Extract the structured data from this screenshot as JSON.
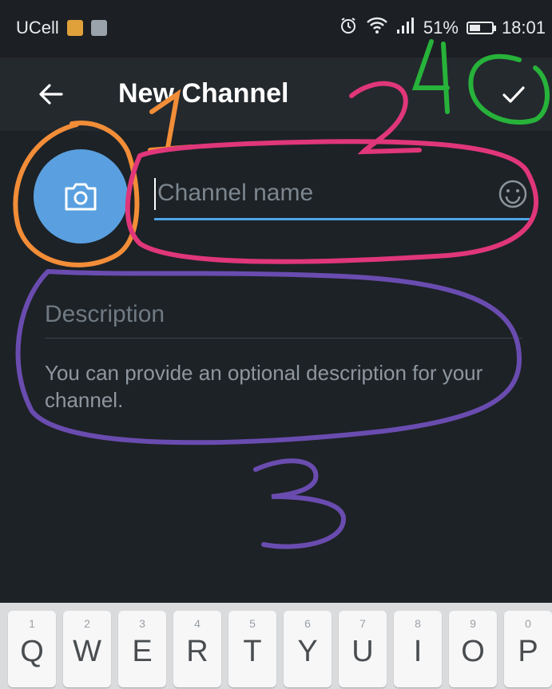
{
  "status_bar": {
    "carrier": "UCell",
    "battery_percent": "51%",
    "battery_level": 0.51,
    "time": "18:01",
    "icons": [
      "keyboard-notification-icon",
      "image-notification-icon",
      "alarm-icon",
      "wifi-icon",
      "signal-icon",
      "battery-icon"
    ]
  },
  "app_bar": {
    "title": "New Channel",
    "back_icon": "arrow-left-icon",
    "done_icon": "checkmark-icon"
  },
  "channel_form": {
    "photo_icon": "camera-icon",
    "name_placeholder": "Channel name",
    "name_value": "",
    "emoji_icon": "smiley-icon",
    "description_placeholder": "Description",
    "description_value": "",
    "hint": "You can provide an optional description for your channel."
  },
  "annotations": {
    "labels": [
      "1",
      "2",
      "3",
      "4"
    ],
    "colors": {
      "1": "#f28d38",
      "2": "#e0367a",
      "3": "#6a4cb0",
      "4": "#27b23a"
    }
  },
  "keyboard": {
    "keys": [
      {
        "num": "1",
        "letter": "Q"
      },
      {
        "num": "2",
        "letter": "W"
      },
      {
        "num": "3",
        "letter": "E"
      },
      {
        "num": "4",
        "letter": "R"
      },
      {
        "num": "5",
        "letter": "T"
      },
      {
        "num": "6",
        "letter": "Y"
      },
      {
        "num": "7",
        "letter": "U"
      },
      {
        "num": "8",
        "letter": "I"
      },
      {
        "num": "9",
        "letter": "O"
      },
      {
        "num": "0",
        "letter": "P"
      }
    ]
  },
  "colors": {
    "background": "#1d2226",
    "app_bar": "#24292e",
    "accent": "#4ea4e6",
    "avatar": "#5aa0e0"
  }
}
